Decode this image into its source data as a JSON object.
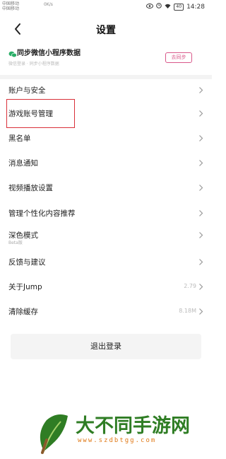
{
  "status_bar": {
    "carrier_1": "中国移动",
    "carrier_2": "中国移动",
    "speed": "0K/s",
    "battery": "40",
    "time": "14:28"
  },
  "header": {
    "title": "设置"
  },
  "sync": {
    "title": "同步微信小程序数据",
    "subtitle": "微信登录 · 同步小程序数据",
    "button": "去同步"
  },
  "settings": {
    "items": [
      {
        "label": "账户与安全"
      },
      {
        "label": "游戏账号管理"
      },
      {
        "label": "黑名单"
      },
      {
        "label": "消息通知"
      },
      {
        "label": "视频播放设置"
      },
      {
        "label": "管理个性化内容推荐"
      },
      {
        "label": "深色模式",
        "sub": "Beta版"
      },
      {
        "label": "反馈与建议"
      },
      {
        "label": "关于Jump",
        "value": "2.79"
      },
      {
        "label": "清除缓存",
        "value": "8.18M"
      }
    ]
  },
  "logout": {
    "label": "退出登录"
  },
  "watermark": {
    "text": "大不同手游网",
    "url": "www.szdbtgg.com"
  },
  "colors": {
    "accent_pink": "#d9588a",
    "highlight_red": "#d9303a",
    "wechat_green": "#2aae67",
    "watermark_green": "#2f7d24"
  }
}
